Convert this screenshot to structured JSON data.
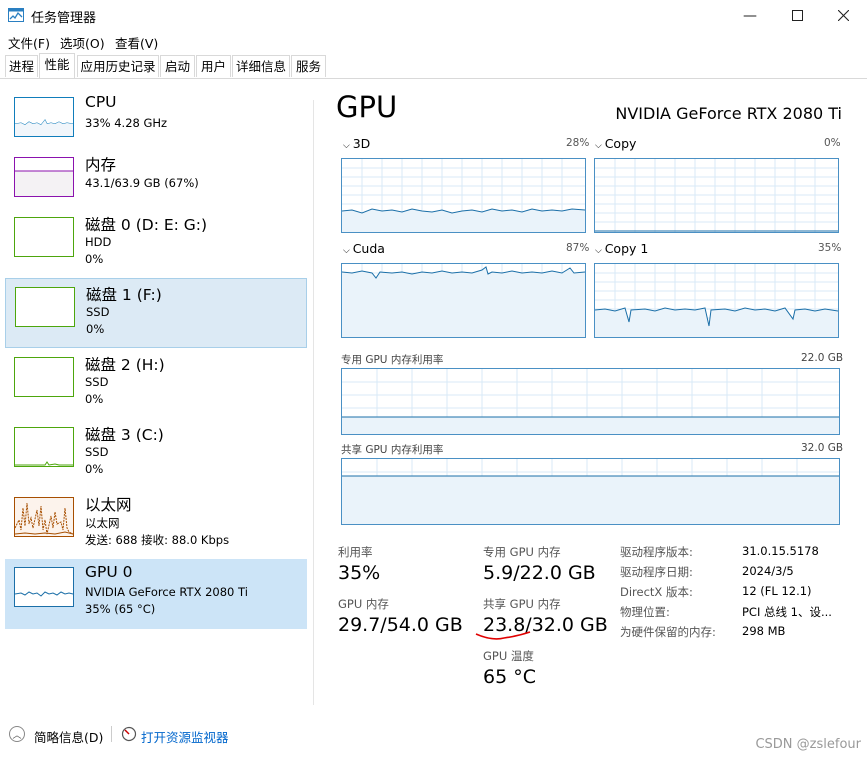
{
  "window": {
    "title": "任务管理器"
  },
  "menu": {
    "file": "文件(F)",
    "options": "选项(O)",
    "view": "查看(V)"
  },
  "tabs": [
    "进程",
    "性能",
    "应用历史记录",
    "启动",
    "用户",
    "详细信息",
    "服务"
  ],
  "colors": {
    "cpu": "#117dbb",
    "memory": "#8b12ae",
    "disk": "#4da60c",
    "ethernet": "#a74f01",
    "gpu": "#1b6fa8",
    "selection": "#cce4f7",
    "annotation": "#e00000"
  },
  "sidebar": {
    "items": [
      {
        "name": "CPU",
        "line1": "33%  4.28 GHz",
        "line2": ""
      },
      {
        "name": "内存",
        "line1": "43.1/63.9 GB (67%)",
        "line2": ""
      },
      {
        "name": "磁盘 0 (D: E: G:)",
        "line1": "HDD",
        "line2": "0%"
      },
      {
        "name": "磁盘 1 (F:)",
        "line1": "SSD",
        "line2": "0%"
      },
      {
        "name": "磁盘 2 (H:)",
        "line1": "SSD",
        "line2": "0%"
      },
      {
        "name": "磁盘 3 (C:)",
        "line1": "SSD",
        "line2": "0%"
      },
      {
        "name": "以太网",
        "line1": "以太网",
        "line2": "发送: 688 接收: 88.0 Kbps"
      },
      {
        "name": "GPU 0",
        "line1": "NVIDIA GeForce RTX 2080 Ti",
        "line2": "35% (65 °C)"
      }
    ]
  },
  "main": {
    "title": "GPU",
    "model": "NVIDIA GeForce RTX 2080 Ti",
    "engines": [
      {
        "name": "3D",
        "pct": "28%"
      },
      {
        "name": "Copy",
        "pct": "0%"
      },
      {
        "name": "Cuda",
        "pct": "87%"
      },
      {
        "name": "Copy 1",
        "pct": "35%"
      }
    ],
    "dedicated_label": "专用 GPU 内存利用率",
    "dedicated_max": "22.0 GB",
    "shared_label": "共享 GPU 内存利用率",
    "shared_max": "32.0 GB",
    "stats": {
      "util_label": "利用率",
      "util_value": "35%",
      "dedicated_label": "专用 GPU 内存",
      "dedicated_value": "5.9/22.0 GB",
      "gpumem_label": "GPU 内存",
      "gpumem_value": "29.7/54.0 GB",
      "shared_label": "共享 GPU 内存",
      "shared_value": "23.8/32.0 GB",
      "temp_label": "GPU 温度",
      "temp_value": "65 °C"
    },
    "details": [
      {
        "k": "驱动程序版本:",
        "v": "31.0.15.5178"
      },
      {
        "k": "驱动程序日期:",
        "v": "2024/3/5"
      },
      {
        "k": "DirectX 版本:",
        "v": "12 (FL 12.1)"
      },
      {
        "k": "物理位置:",
        "v": "PCI 总线 1、设..."
      },
      {
        "k": "为硬件保留的内存:",
        "v": "298 MB"
      }
    ]
  },
  "footer": {
    "brief": "简略信息(D)",
    "monitor": "打开资源监视器"
  },
  "watermark": "CSDN @zslefour"
}
